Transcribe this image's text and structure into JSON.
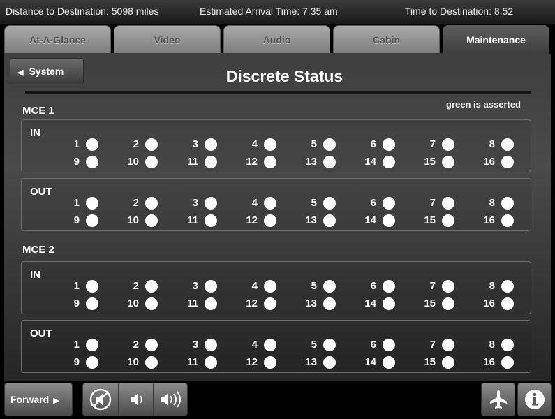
{
  "status": {
    "distance": "Distance to Destination: 5098 miles",
    "eta": "Estimated Arrival Time: 7.35 am",
    "time_to_destination": "Time to Destination: 8:52"
  },
  "tabs": [
    {
      "label": "At-A-Glance",
      "active": false
    },
    {
      "label": "Video",
      "active": false
    },
    {
      "label": "Audio",
      "active": false
    },
    {
      "label": "Cabin",
      "active": false
    },
    {
      "label": "Maintenance",
      "active": true
    }
  ],
  "header": {
    "back_label": "System",
    "title": "Discrete Status",
    "legend_note": "green is asserted"
  },
  "groups": [
    {
      "title": "MCE 1",
      "sections": [
        {
          "label": "IN",
          "row1": [
            "1",
            "2",
            "3",
            "4",
            "5",
            "6",
            "7",
            "8"
          ],
          "row2": [
            "9",
            "10",
            "11",
            "12",
            "13",
            "14",
            "15",
            "16"
          ]
        },
        {
          "label": "OUT",
          "row1": [
            "1",
            "2",
            "3",
            "4",
            "5",
            "6",
            "7",
            "8"
          ],
          "row2": [
            "9",
            "10",
            "11",
            "12",
            "13",
            "14",
            "15",
            "16"
          ]
        }
      ]
    },
    {
      "title": "MCE 2",
      "sections": [
        {
          "label": "IN",
          "row1": [
            "1",
            "2",
            "3",
            "4",
            "5",
            "6",
            "7",
            "8"
          ],
          "row2": [
            "9",
            "10",
            "11",
            "12",
            "13",
            "14",
            "15",
            "16"
          ]
        },
        {
          "label": "OUT",
          "row1": [
            "1",
            "2",
            "3",
            "4",
            "5",
            "6",
            "7",
            "8"
          ],
          "row2": [
            "9",
            "10",
            "11",
            "12",
            "13",
            "14",
            "15",
            "16"
          ]
        }
      ]
    }
  ],
  "footer": {
    "forward_label": "Forward",
    "icons": [
      "mute-icon",
      "volume-down-icon",
      "volume-up-icon",
      "airplane-icon",
      "info-icon"
    ]
  },
  "colors": {
    "indicator_off": "#ffffff",
    "indicator_asserted": "#00cc00",
    "active_tab": "#4a4a4a"
  }
}
